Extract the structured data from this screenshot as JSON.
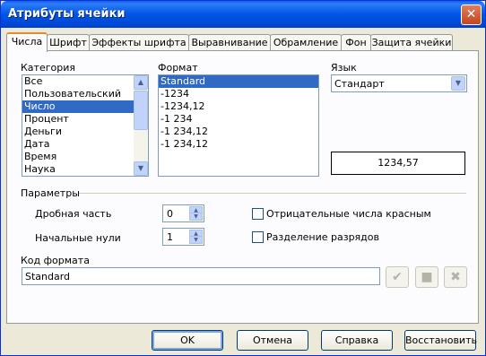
{
  "window": {
    "title": "Атрибуты ячейки",
    "close_glyph": "✕"
  },
  "tabs": [
    {
      "label": "Числа"
    },
    {
      "label": "Шрифт"
    },
    {
      "label": "Эффекты шрифта"
    },
    {
      "label": "Выравнивание"
    },
    {
      "label": "Обрамление"
    },
    {
      "label": "Фон"
    },
    {
      "label": "Защита ячейки"
    }
  ],
  "category": {
    "label": "Категория",
    "items": [
      "Все",
      "Пользовательский",
      "Число",
      "Процент",
      "Деньги",
      "Дата",
      "Время",
      "Наука"
    ],
    "selected_index": 2
  },
  "format": {
    "label": "Формат",
    "items": [
      "Standard",
      "-1234",
      "-1234,12",
      "-1 234",
      "-1 234,12",
      "-1 234,12"
    ],
    "selected_index": 0
  },
  "language": {
    "label": "Язык",
    "value": "Стандарт"
  },
  "preview": {
    "value": "1234,57"
  },
  "options": {
    "heading": "Параметры",
    "decimals_label": "Дробная часть",
    "decimals_value": "0",
    "leading_zeros_label": "Начальные нули",
    "leading_zeros_value": "1",
    "negative_red_label": "Отрицательные числа красным",
    "thousands_sep_label": "Разделение разрядов"
  },
  "format_code": {
    "label": "Код формата",
    "value": "Standard"
  },
  "icons": {
    "accept": "check-icon",
    "edit": "comment-icon",
    "delete": "delete-icon"
  },
  "buttons": {
    "ok": "OK",
    "cancel": "Отмена",
    "help": "Справка",
    "reset": "Восстановить"
  },
  "colors": {
    "selection": "#316ac5",
    "titlebar": "#0055e5",
    "dialog_bg": "#ece9d8"
  }
}
